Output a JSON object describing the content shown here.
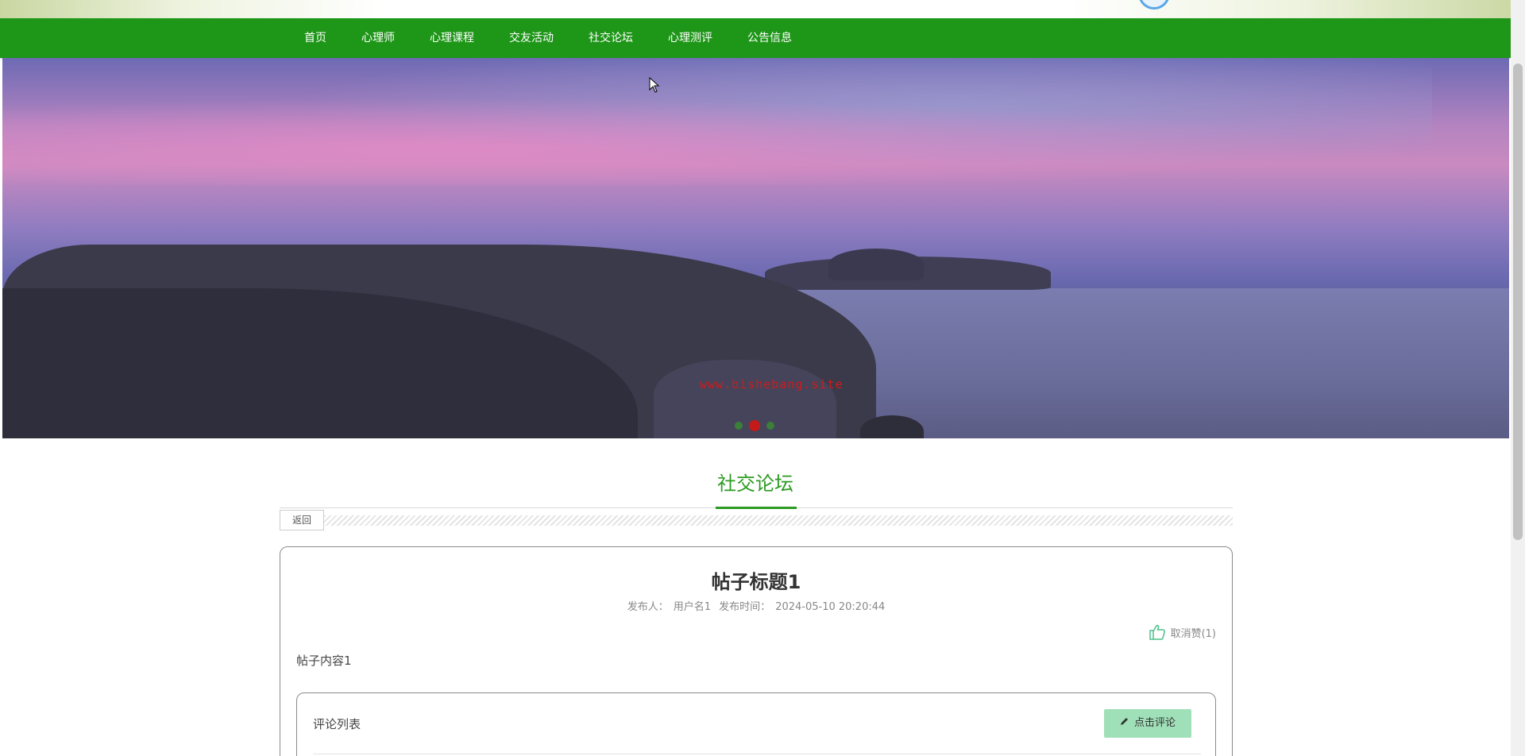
{
  "nav": {
    "items": [
      "首页",
      "心理师",
      "心理课程",
      "交友活动",
      "社交论坛",
      "心理测评",
      "公告信息"
    ]
  },
  "banner": {
    "watermark": "www.bishebang.site",
    "active_slide": 2,
    "slide_count": 3
  },
  "section": {
    "title": "社交论坛",
    "back_label": "返回"
  },
  "post": {
    "title": "帖子标题1",
    "author_label": "发布人：",
    "author": "用户名1",
    "time_label": "发布时间：",
    "time": "2024-05-10 20:20:44",
    "like_label": "取消赞(1)",
    "content": "帖子内容1"
  },
  "comments": {
    "label": "评论列表",
    "button_label": "点击评论"
  },
  "colors": {
    "nav_bg": "#1e9618",
    "accent": "#2c9b22",
    "comment_button": "#9fe0b8"
  }
}
